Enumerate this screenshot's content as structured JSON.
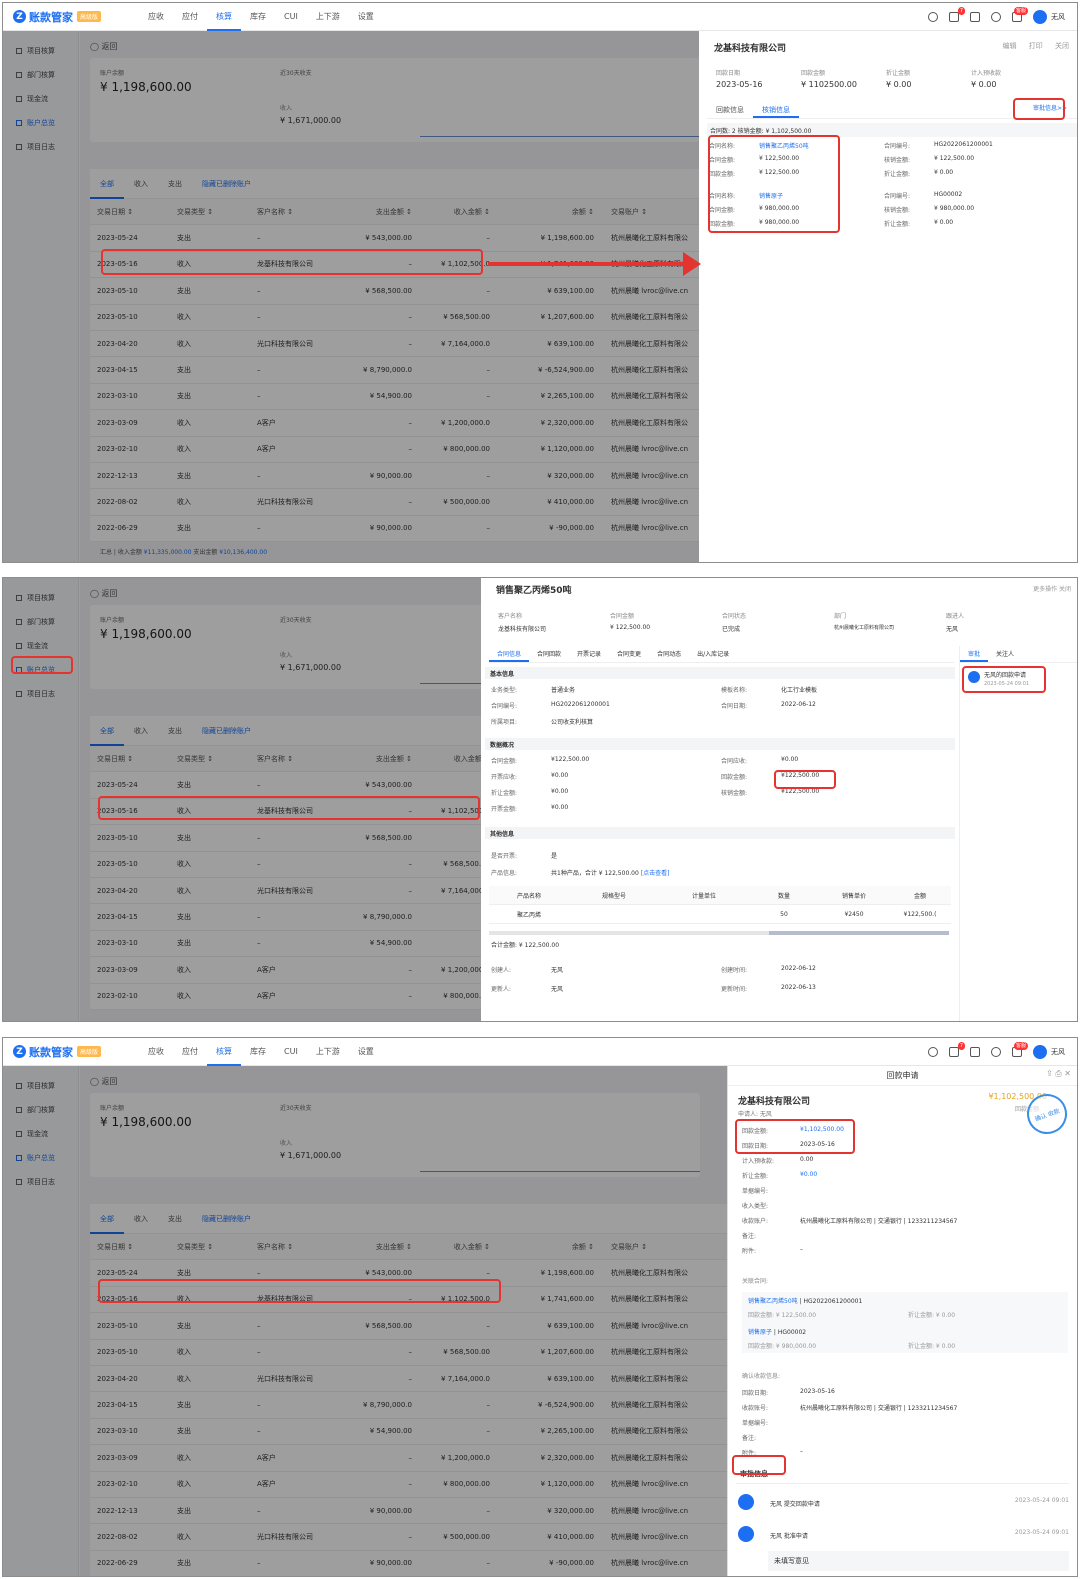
{
  "app": {
    "name": "账款管家",
    "badge": "高级版",
    "logo_letter": "Z"
  },
  "nav": [
    "应收",
    "应付",
    "核算",
    "库存",
    "CUI",
    "上下游",
    "设置"
  ],
  "nav_active": 2,
  "topbar": {
    "notif_count": "7",
    "badge_new": "客服",
    "user": "无风"
  },
  "sidebar": [
    "项目核算",
    "部门核算",
    "现金流",
    "账户总览",
    "项目日志"
  ],
  "sidebar_active": 3,
  "account": {
    "back": "返回",
    "balance_label": "账户余额",
    "balance": "¥ 1,198,600.00",
    "recent_label": "近30天收支",
    "income_label": "收入",
    "income": "¥ 1,671,000.00"
  },
  "tabs": [
    "全部",
    "收入",
    "支出",
    "隐藏已删除账户"
  ],
  "table": {
    "headers": [
      "交易日期 ↕",
      "交易类型 ↕",
      "客户名称 ↕",
      "支出金额 ↕",
      "收入金额 ↕",
      "余额 ↕",
      "交易账户 ↕"
    ],
    "rows": [
      [
        "2023-05-24",
        "支出",
        "–",
        "¥ 543,000.00",
        "–",
        "¥ 1,198,600.00",
        "杭州晨曦化工原料有限公"
      ],
      [
        "2023-05-16",
        "收入",
        "龙基科技有限公司",
        "–",
        "¥ 1,102,500.0",
        "¥ 1,741,600.00",
        "杭州晨曦化工原料有限公"
      ],
      [
        "2023-05-10",
        "支出",
        "–",
        "¥ 568,500.00",
        "–",
        "¥ 639,100.00",
        "杭州晨曦 lvroc@live.cn"
      ],
      [
        "2023-05-10",
        "收入",
        "–",
        "–",
        "¥ 568,500.00",
        "¥ 1,207,600.00",
        "杭州晨曦化工原料有限公"
      ],
      [
        "2023-04-20",
        "收入",
        "光口科技有限公司",
        "–",
        "¥ 7,164,000.0",
        "¥ 639,100.00",
        "杭州晨曦化工原料有限公"
      ],
      [
        "2023-04-15",
        "支出",
        "–",
        "¥ 8,790,000.0",
        "–",
        "¥ -6,524,900.00",
        "杭州晨曦化工原料有限公"
      ],
      [
        "2023-03-10",
        "支出",
        "–",
        "¥ 54,900.00",
        "–",
        "¥ 2,265,100.00",
        "杭州晨曦化工原料有限公"
      ],
      [
        "2023-03-09",
        "收入",
        "A客户",
        "–",
        "¥ 1,200,000.0",
        "¥ 2,320,000.00",
        "杭州晨曦化工原料有限公"
      ],
      [
        "2023-02-10",
        "收入",
        "A客户",
        "–",
        "¥ 800,000.00",
        "¥ 1,120,000.00",
        "杭州晨曦 lvroc@live.cn"
      ],
      [
        "2022-12-13",
        "支出",
        "–",
        "¥ 90,000.00",
        "–",
        "¥ 320,000.00",
        "杭州晨曦 lvroc@live.cn"
      ],
      [
        "2022-08-02",
        "收入",
        "光口科技有限公司",
        "–",
        "¥ 500,000.00",
        "¥ 410,000.00",
        "杭州晨曦 lvroc@live.cn"
      ],
      [
        "2022-06-29",
        "支出",
        "–",
        "¥ 90,000.00",
        "–",
        "¥ -90,000.00",
        "杭州晨曦 lvroc@live.cn"
      ]
    ],
    "summary_prefix": "汇总 | 收入金额 ",
    "summary_income": "¥11,335,000.00",
    "summary_mid": " 支出金额 ",
    "summary_expense": "¥10,136,400.00"
  },
  "panel1": {
    "title": "龙基科技有限公司",
    "actions": [
      "编辑",
      "打印",
      "关闭"
    ],
    "kv": [
      {
        "label": "回款日期",
        "value": "2023-05-16"
      },
      {
        "label": "回款金额",
        "value": "¥ 1102500.00"
      },
      {
        "label": "折让金额",
        "value": "¥ 0.00"
      },
      {
        "label": "计入预收款",
        "value": "¥ 0.00"
      }
    ],
    "tabs": [
      "回款信息",
      "核销信息"
    ],
    "audit_link": "审批信息>>",
    "summary": "合同数:  2    核销金额: ¥ 1,102,500.00",
    "writeoffs": [
      {
        "name_l": "合同名称:",
        "name": "销售聚乙丙烯50吨",
        "no_l": "合同编号:",
        "no": "HG2022061200001",
        "amt_l": "合同金额:",
        "amt": "¥ 122,500.00",
        "wo_l": "核销金额:",
        "wo": "¥ 122,500.00",
        "back_l": "回款金额:",
        "back": "¥ 122,500.00",
        "disc_l": "折让金额:",
        "disc": "¥ 0.00"
      },
      {
        "name_l": "合同名称:",
        "name": "销售原子",
        "no_l": "合同编号:",
        "no": "HG00002",
        "amt_l": "合同金额:",
        "amt": "¥ 980,000.00",
        "wo_l": "核销金额:",
        "wo": "¥ 980,000.00",
        "back_l": "回款金额:",
        "back": "¥ 980,000.00",
        "disc_l": "折让金额:",
        "disc": "¥ 0.00"
      }
    ]
  },
  "panel2": {
    "title": "销售聚乙丙烯50吨",
    "actions": "更多操作    关闭",
    "heads": [
      {
        "label": "客户名称",
        "value": "龙基科技有限公司"
      },
      {
        "label": "合同金额",
        "value": "¥ 122,500.00"
      },
      {
        "label": "合同状态",
        "value": "已完成"
      },
      {
        "label": "部门",
        "value": "杭州晨曦化工原料有限公司"
      },
      {
        "label": "跟进人",
        "value": "无风"
      }
    ],
    "tabs": [
      "合同信息",
      "合同回款",
      "开票记录",
      "合同变更",
      "合同动态",
      "出/入库记录"
    ],
    "sec_basic": "基本信息",
    "basic": [
      [
        "业务类型:",
        "普通业务",
        "模板名称:",
        "化工行业模板"
      ],
      [
        "合同编号:",
        "HG2022061200001",
        "合同日期:",
        "2022-06-12"
      ],
      [
        "所属项目:",
        "公司收支利核算",
        "",
        ""
      ]
    ],
    "sec_data": "数据概况",
    "data": [
      [
        "合同金额:",
        "¥122,500.00",
        "合同应收:",
        "¥0.00"
      ],
      [
        "开票应收:",
        "¥0.00",
        "回款金额:",
        "¥122,500.00"
      ],
      [
        "折让金额:",
        "¥0.00",
        "核销金额:",
        "¥122,500.00"
      ],
      [
        "开票金额:",
        "¥0.00",
        "",
        ""
      ]
    ],
    "sec_other": "其他信息",
    "other_invoice_l": "是否开票:",
    "other_invoice": "是",
    "product_l": "产品信息:",
    "product": "共1种产品，合计 ¥ 122,500.00",
    "product_link": "[点击查看]",
    "ptable_head": [
      "产品名称",
      "规格型号",
      "计量单位",
      "数量",
      "销售单价",
      "金额"
    ],
    "ptable_row": [
      "聚乙丙烯",
      "",
      "",
      "50",
      "¥2450",
      "¥122,500.("
    ],
    "total": "合计金额:  ¥ 122,500.00",
    "creator_l": "创建人:",
    "creator": "无风",
    "ctime_l": "创建时间:",
    "ctime": "2022-06-12",
    "updater_l": "更新人:",
    "updater": "无风",
    "utime_l": "更新时间:",
    "utime": "2022-06-13",
    "rtabs": [
      "审批",
      "关注人"
    ],
    "rbadge": "无风的回款申请",
    "rbadge_time": "2023-05-24 09:01"
  },
  "panel3": {
    "head": "回款申请",
    "company": "龙基科技有限公司",
    "applicant": "申请人: 无风",
    "amount": "¥1,102,500.00",
    "amount_label": "回款金额",
    "stamp": "确认\n收款",
    "rows": [
      [
        "回款金额:",
        "¥1,102,500.00"
      ],
      [
        "回款日期:",
        "2023-05-16"
      ],
      [
        "计入预收款:",
        "0.00"
      ],
      [
        "折让金额:",
        "¥0.00"
      ],
      [
        "单据编号:",
        ""
      ],
      [
        "收入类型:",
        ""
      ],
      [
        "收款账户:",
        "杭州晨曦化工原料有限公司 | 交通银行 | 1233211234567"
      ],
      [
        "备注:",
        ""
      ],
      [
        "附件:",
        "–"
      ]
    ],
    "rel_label": "关联合同:",
    "rel": [
      {
        "name": "销售聚乙丙烯50吨",
        "no": "HG2022061200001",
        "back": "回款金额:  ¥ 122,500.00",
        "disc": "折让金额:  ¥ 0.00"
      },
      {
        "name": "销售原子",
        "no": "HG00002",
        "back": "回款金额:  ¥ 980,000.00",
        "disc": "折让金额:  ¥ 0.00"
      }
    ],
    "confirm_label": "确认收款信息:",
    "confirm": [
      [
        "回款日期:",
        "2023-05-16"
      ],
      [
        "收款账号:",
        "杭州晨曦化工原料有限公司 | 交通银行 | 1233211234567"
      ],
      [
        "单据编号:",
        ""
      ],
      [
        "备注:",
        ""
      ],
      [
        "附件:",
        "–"
      ]
    ],
    "approval_title": "审批信息",
    "approvals": [
      {
        "name": "无风  提交回款申请",
        "time": "2023-05-24 09:01"
      },
      {
        "name": "无风  批准申请",
        "time": "2023-05-24 09:01"
      }
    ],
    "note": "未填写意见"
  },
  "colors": {
    "accent": "#1d6ff2",
    "highlight": "#e3342f"
  }
}
